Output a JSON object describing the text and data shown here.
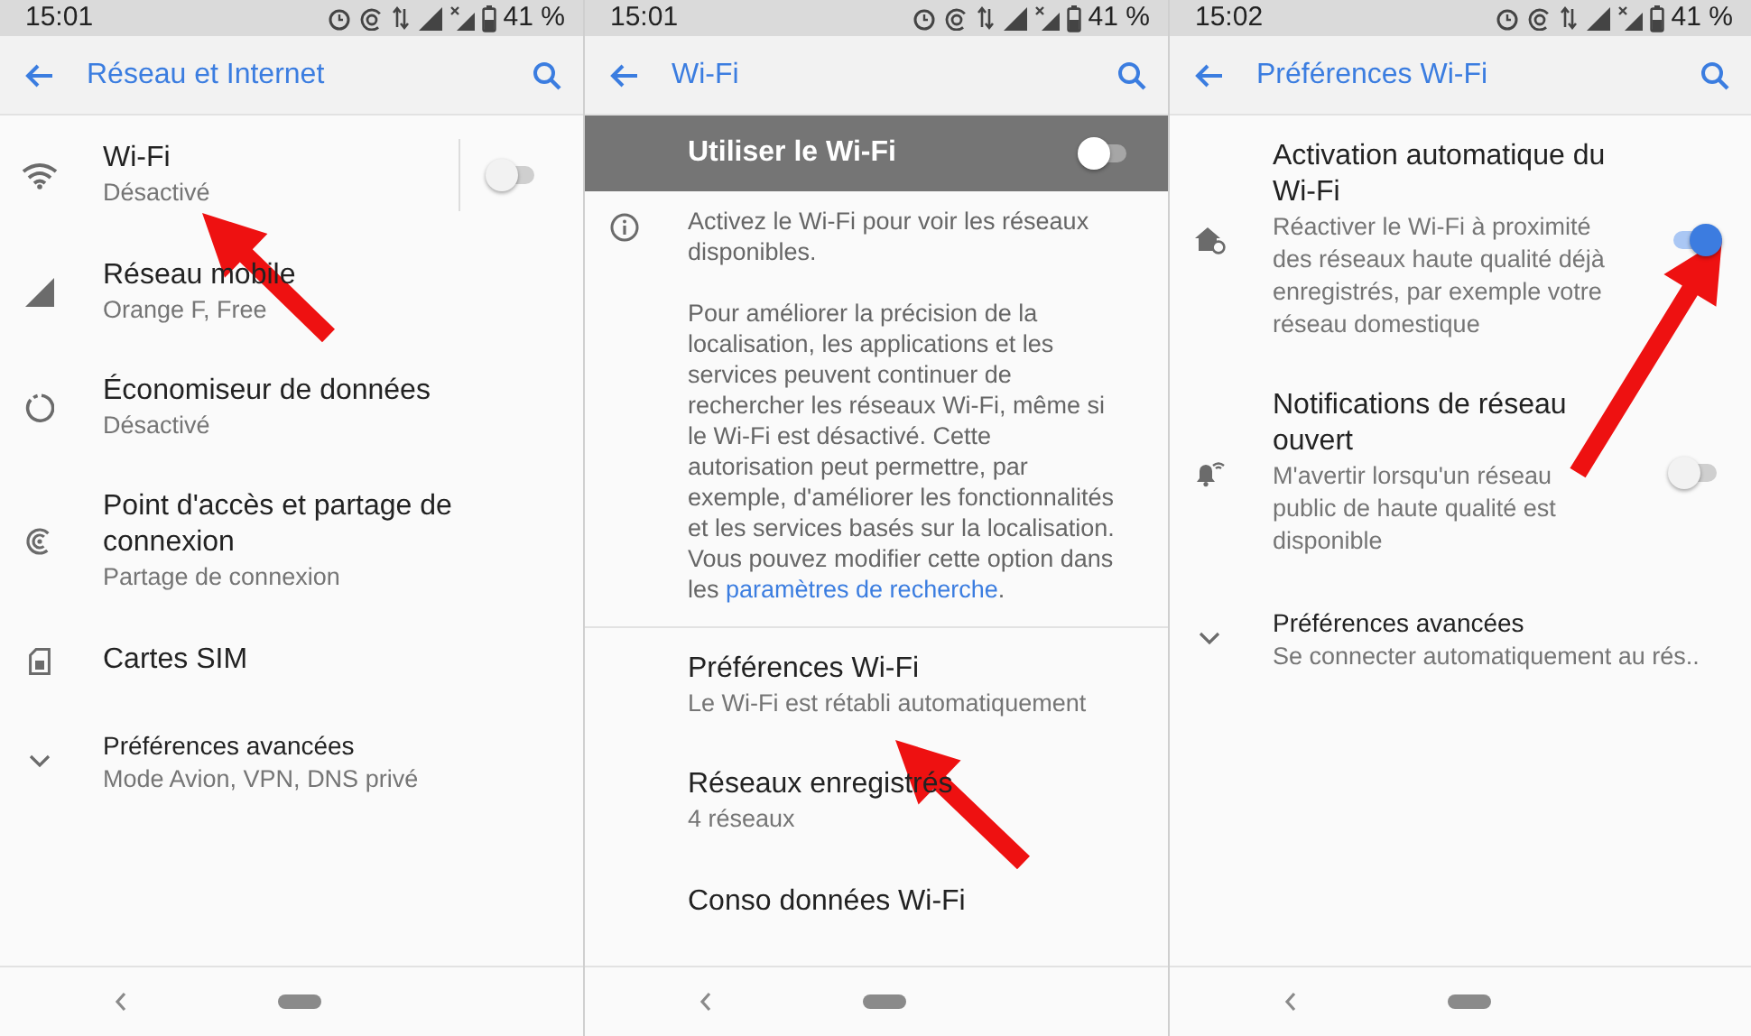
{
  "panels": [
    {
      "status_bar": {
        "time": "15:01",
        "battery": "41 %"
      },
      "title": "Réseau et Internet",
      "items": [
        {
          "kind": "split-switch",
          "title": "Wi-Fi",
          "subtitle": "Désactivé",
          "on": false
        },
        {
          "kind": "link",
          "title": "Réseau mobile",
          "subtitle": "Orange F, Free"
        },
        {
          "kind": "link",
          "title": "Économiseur de données",
          "subtitle": "Désactivé"
        },
        {
          "kind": "link",
          "title": "Point d'accès et partage de connexion",
          "subtitle": "Partage de connexion"
        },
        {
          "kind": "link",
          "title": "Cartes SIM"
        },
        {
          "kind": "expand",
          "title": "Préférences avancées",
          "subtitle": "Mode Avion, VPN, DNS privé"
        }
      ]
    },
    {
      "status_bar": {
        "time": "15:01",
        "battery": "41 %"
      },
      "title": "Wi-Fi",
      "items": [
        {
          "kind": "master-switch",
          "title": "Utiliser le Wi-Fi",
          "on": false
        },
        {
          "kind": "info",
          "paragraphs": [
            {
              "text": "Activez le Wi-Fi pour voir les réseaux disponibles."
            },
            {
              "text": "Pour améliorer la précision de la localisation, les applications et les services peuvent continuer de rechercher les réseaux Wi-Fi, même si le Wi-Fi est désactivé. Cette autorisation peut permettre, par exemple, d'améliorer les fonctionnalités et les services basés sur la localisation. Vous pouvez modifier cette option dans les ",
              "link": "paramètres de recherche",
              "after": "."
            }
          ]
        },
        {
          "kind": "link",
          "title": "Préférences Wi-Fi",
          "subtitle": "Le Wi-Fi est rétabli automatiquement"
        },
        {
          "kind": "link",
          "title": "Réseaux enregistrés",
          "subtitle": "4 réseaux"
        },
        {
          "kind": "link",
          "title": "Conso données Wi-Fi"
        }
      ]
    },
    {
      "status_bar": {
        "time": "15:02",
        "battery": "41 %"
      },
      "title": "Préférences Wi-Fi",
      "items": [
        {
          "kind": "switch",
          "title": "Activation automatique du Wi-Fi",
          "subtitle": "Réactiver le Wi-Fi à proximité des réseaux haute qualité déjà enregistrés, par exemple votre réseau domestique",
          "on": true
        },
        {
          "kind": "switch",
          "title": "Notifications de réseau ouvert",
          "subtitle": "M'avertir lorsqu'un réseau public de haute qualité est disponible",
          "on": false
        },
        {
          "kind": "expand",
          "title": "Préférences avancées",
          "subtitle": "Se connecter automatiquement au rés.."
        }
      ]
    }
  ]
}
